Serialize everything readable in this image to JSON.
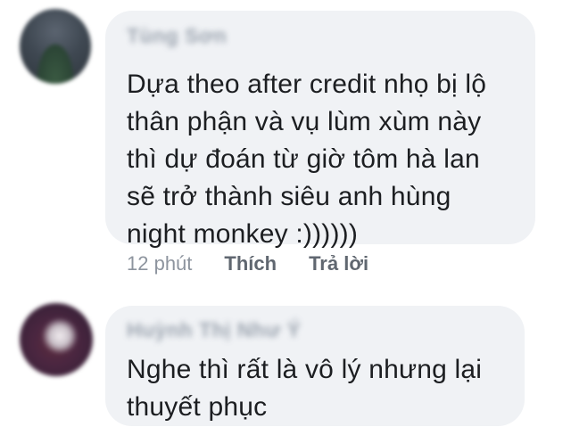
{
  "comments": [
    {
      "author": "Tùng Sơn",
      "lines": [
        "Dựa theo after credit nhọ bị lộ",
        "thân phận và vụ lùm xùm này",
        "thì dự đoán từ giờ tôm hà lan",
        "sẽ trở thành siêu anh hùng",
        "night monkey :))))))"
      ],
      "time": "12 phút",
      "like_label": "Thích",
      "reply_label": "Trả lời"
    },
    {
      "author": "Huỳnh Thị Như Ý",
      "lines": [
        "Nghe thì rất là vô lý nhưng lại",
        "thuyết phục"
      ]
    }
  ]
}
